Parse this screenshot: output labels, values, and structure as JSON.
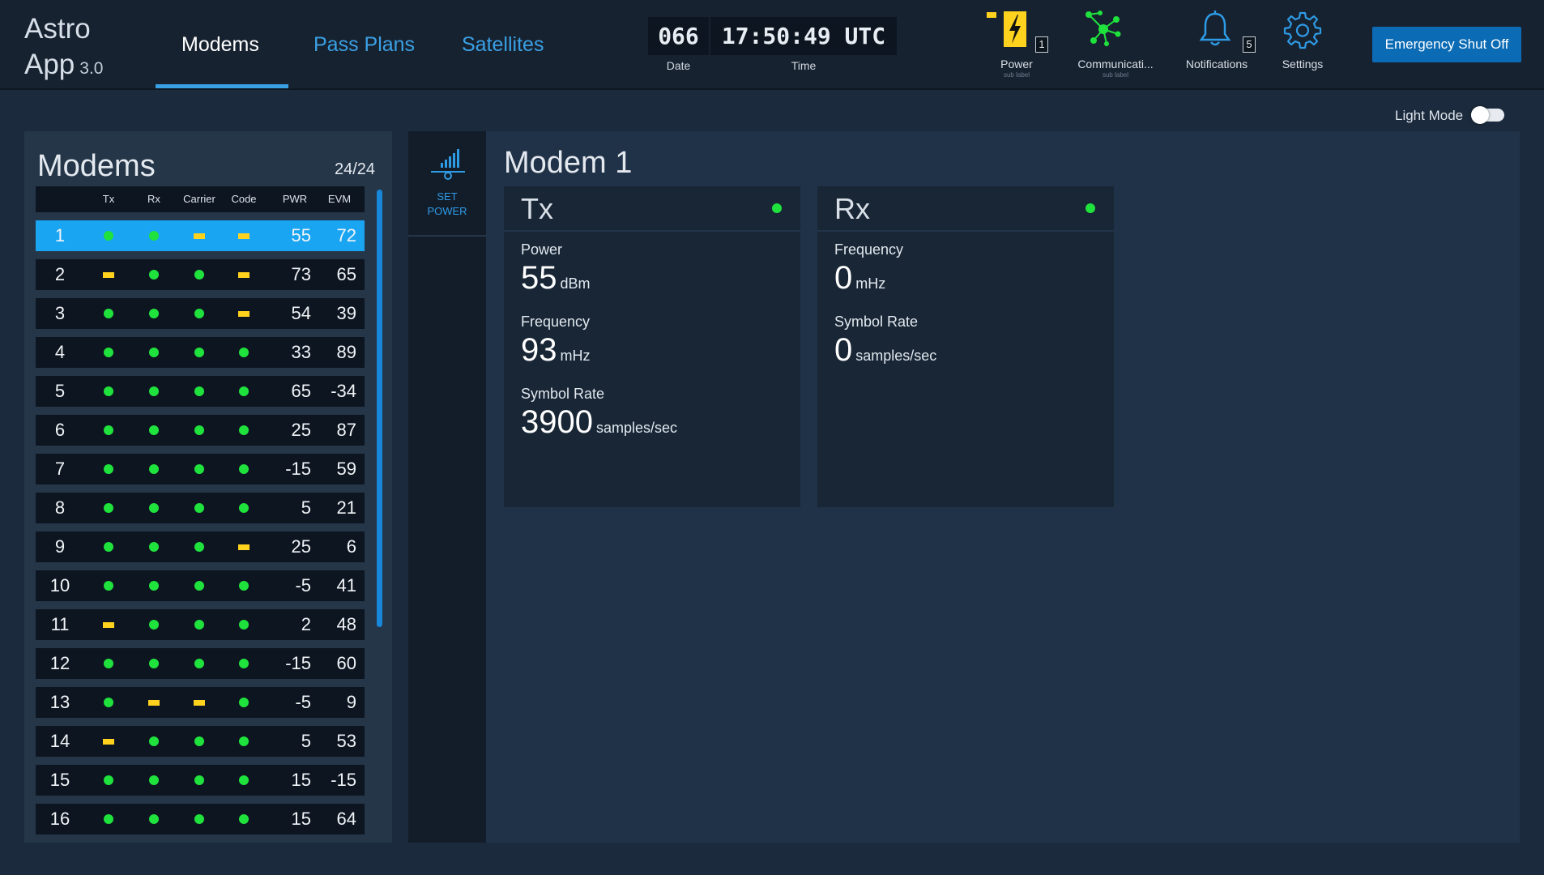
{
  "app": {
    "title_line1": "Astro",
    "title_line2": "App",
    "version": "3.0"
  },
  "nav": {
    "tabs": [
      {
        "label": "Modems",
        "active": true
      },
      {
        "label": "Pass Plans",
        "active": false
      },
      {
        "label": "Satellites",
        "active": false
      }
    ]
  },
  "clock": {
    "date": "066",
    "time": "17:50:49 UTC",
    "date_label": "Date",
    "time_label": "Time"
  },
  "status": {
    "power": {
      "label": "Power",
      "sub_label": "sub label",
      "badge": "1",
      "icon": "lightning-bolt-icon"
    },
    "communications": {
      "label": "Communicati...",
      "sub_label": "sub label",
      "icon": "network-nodes-icon"
    },
    "notifications": {
      "label": "Notifications",
      "badge": "5",
      "icon": "bell-icon"
    },
    "settings": {
      "label": "Settings",
      "icon": "gear-icon"
    }
  },
  "emergency_button": {
    "label": "Emergency Shut Off"
  },
  "light_mode": {
    "label": "Light Mode",
    "enabled": false
  },
  "modem_list": {
    "title": "Modems",
    "count": "24/24",
    "columns": [
      "Tx",
      "Rx",
      "Carrier",
      "Code",
      "PWR",
      "EVM"
    ],
    "rows": [
      {
        "id": "1",
        "tx": "ok",
        "rx": "ok",
        "carrier": "warn",
        "code": "warn",
        "pwr": "55",
        "evm": "72",
        "selected": true
      },
      {
        "id": "2",
        "tx": "warn",
        "rx": "ok",
        "carrier": "ok",
        "code": "warn",
        "pwr": "73",
        "evm": "65"
      },
      {
        "id": "3",
        "tx": "ok",
        "rx": "ok",
        "carrier": "ok",
        "code": "warn",
        "pwr": "54",
        "evm": "39"
      },
      {
        "id": "4",
        "tx": "ok",
        "rx": "ok",
        "carrier": "ok",
        "code": "ok",
        "pwr": "33",
        "evm": "89"
      },
      {
        "id": "5",
        "tx": "ok",
        "rx": "ok",
        "carrier": "ok",
        "code": "ok",
        "pwr": "65",
        "evm": "-34"
      },
      {
        "id": "6",
        "tx": "ok",
        "rx": "ok",
        "carrier": "ok",
        "code": "ok",
        "pwr": "25",
        "evm": "87"
      },
      {
        "id": "7",
        "tx": "ok",
        "rx": "ok",
        "carrier": "ok",
        "code": "ok",
        "pwr": "-15",
        "evm": "59"
      },
      {
        "id": "8",
        "tx": "ok",
        "rx": "ok",
        "carrier": "ok",
        "code": "ok",
        "pwr": "5",
        "evm": "21"
      },
      {
        "id": "9",
        "tx": "ok",
        "rx": "ok",
        "carrier": "ok",
        "code": "warn",
        "pwr": "25",
        "evm": "6"
      },
      {
        "id": "10",
        "tx": "ok",
        "rx": "ok",
        "carrier": "ok",
        "code": "ok",
        "pwr": "-5",
        "evm": "41"
      },
      {
        "id": "11",
        "tx": "warn",
        "rx": "ok",
        "carrier": "ok",
        "code": "ok",
        "pwr": "2",
        "evm": "48"
      },
      {
        "id": "12",
        "tx": "ok",
        "rx": "ok",
        "carrier": "ok",
        "code": "ok",
        "pwr": "-15",
        "evm": "60"
      },
      {
        "id": "13",
        "tx": "ok",
        "rx": "warn",
        "carrier": "warn",
        "code": "ok",
        "pwr": "-5",
        "evm": "9"
      },
      {
        "id": "14",
        "tx": "warn",
        "rx": "ok",
        "carrier": "ok",
        "code": "ok",
        "pwr": "5",
        "evm": "53"
      },
      {
        "id": "15",
        "tx": "ok",
        "rx": "ok",
        "carrier": "ok",
        "code": "ok",
        "pwr": "15",
        "evm": "-15"
      },
      {
        "id": "16",
        "tx": "ok",
        "rx": "ok",
        "carrier": "ok",
        "code": "ok",
        "pwr": "15",
        "evm": "64"
      }
    ]
  },
  "tools": {
    "set_power": {
      "line1": "SET",
      "line2": "POWER",
      "icon": "signal-bars-icon"
    }
  },
  "detail": {
    "title": "Modem 1",
    "tx": {
      "title": "Tx",
      "status": "ok",
      "fields": [
        {
          "label": "Power",
          "value": "55",
          "unit": "dBm"
        },
        {
          "label": "Frequency",
          "value": "93",
          "unit": "mHz"
        },
        {
          "label": "Symbol Rate",
          "value": "3900",
          "unit": "samples/sec"
        }
      ]
    },
    "rx": {
      "title": "Rx",
      "status": "ok",
      "fields": [
        {
          "label": "Frequency",
          "value": "0",
          "unit": "mHz"
        },
        {
          "label": "Symbol Rate",
          "value": "0",
          "unit": "samples/sec"
        }
      ]
    }
  },
  "colors": {
    "accent": "#3aa0e4",
    "status_ok": "#1fe23d",
    "status_warn": "#ffd21e",
    "selected_row": "#1aa5f3",
    "emergency": "#0b6bb5"
  }
}
